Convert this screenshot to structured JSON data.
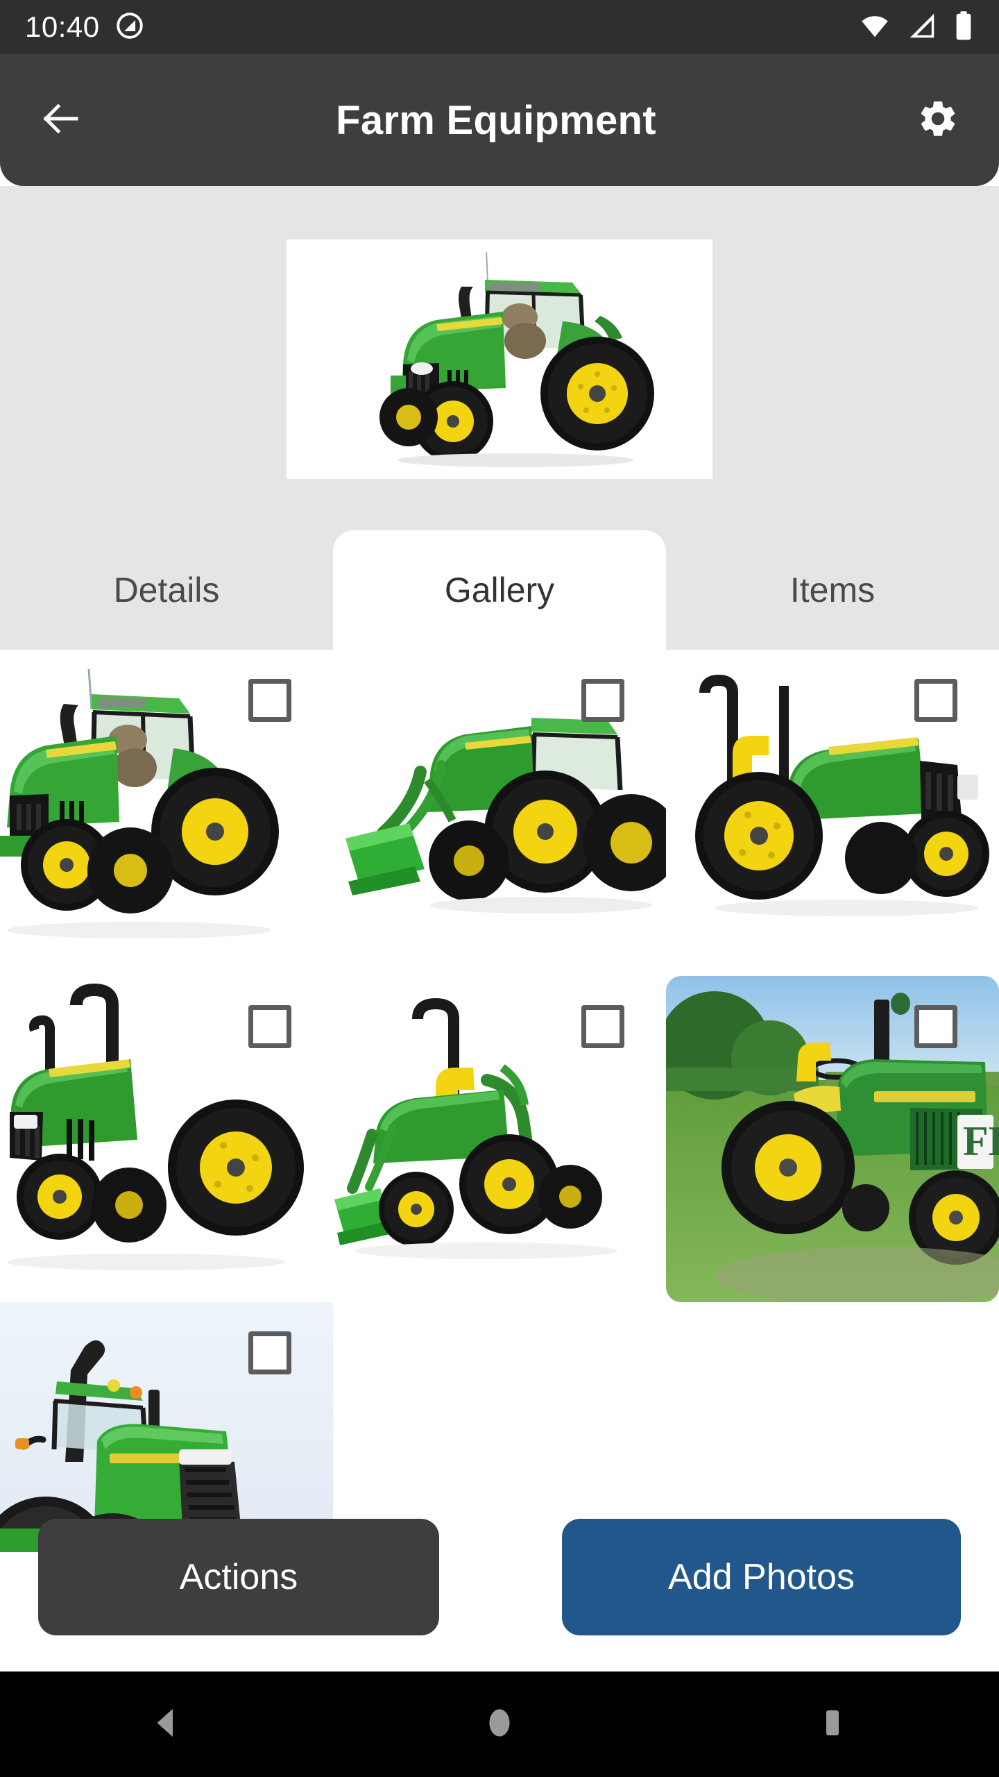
{
  "status_bar": {
    "time": "10:40",
    "icons": [
      "do-not-disturb-icon",
      "wifi-icon",
      "cellular-signal-icon",
      "battery-icon"
    ]
  },
  "app_bar": {
    "back_label": "back-arrow-icon",
    "title": "Farm Equipment",
    "settings_label": "gear-icon"
  },
  "hero": {
    "alt": "Green John Deere utility tractor on white background"
  },
  "tabs": [
    {
      "label": "Details",
      "active": false
    },
    {
      "label": "Gallery",
      "active": true
    },
    {
      "label": "Items",
      "active": false
    }
  ],
  "gallery": {
    "selection_checkbox_state": "unchecked",
    "photos": [
      {
        "alt": "Green tractor with cab, front-left three-quarter view",
        "style": "cab-tractor",
        "background": "white",
        "rounded": false,
        "checkbox": "unchecked"
      },
      {
        "alt": "Green tractor with front loader bucket",
        "style": "loader-tractor",
        "background": "white",
        "rounded": false,
        "checkbox": "unchecked"
      },
      {
        "alt": "Green open-station utility tractor, right side view",
        "style": "open-tractor",
        "background": "white",
        "rounded": false,
        "checkbox": "unchecked"
      },
      {
        "alt": "Green open-station tractor, front-left view",
        "style": "open-tractor-2",
        "background": "white",
        "rounded": false,
        "checkbox": "unchecked"
      },
      {
        "alt": "Compact green tractor with loader and backhoe",
        "style": "backhoe-tractor",
        "background": "white",
        "rounded": false,
        "checkbox": "unchecked"
      },
      {
        "alt": "Vintage green tractor parked in a grass field",
        "style": "vintage-field",
        "background": "photo",
        "rounded": true,
        "checkbox": "unchecked"
      },
      {
        "alt": "Large articulated green tractor close-up under sky",
        "style": "big-tractor",
        "background": "sky",
        "rounded": false,
        "checkbox": "unchecked"
      }
    ]
  },
  "bottom_buttons": {
    "secondary": "Actions",
    "primary": "Add Photos"
  },
  "nav_bar": {
    "back": "nav-back-icon",
    "home": "nav-home-icon",
    "recents": "nav-recents-icon"
  },
  "colors": {
    "status_bar_bg": "#2e2f31",
    "app_bar_bg": "#3e3e40",
    "header_bg": "#e5e5e5",
    "tab_active_bg": "#ffffff",
    "tab_text": "#4a4a4a",
    "primary_button": "#21578a",
    "secondary_button": "#3e3e40",
    "nav_bar_bg": "#000000",
    "nav_icon": "#9a9a9a",
    "checkbox_border": "#5c5c5c"
  }
}
